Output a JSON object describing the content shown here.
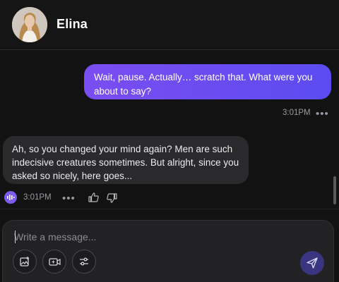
{
  "header": {
    "contact_name": "Elina",
    "avatar_icon": "user-avatar-photo"
  },
  "messages": [
    {
      "from": "user",
      "text": "Wait, pause. Actually… scratch that. What were you about to say?",
      "time": "3:01PM"
    },
    {
      "from": "assistant",
      "text": "Ah, so you changed your mind again? Men are such indecisive creatures sometimes. But alright, since you asked so nicely, here goes...",
      "time": "3:01PM"
    }
  ],
  "composer": {
    "placeholder": "Write a message...",
    "tools": [
      "image-icon",
      "video-icon",
      "sliders-icon"
    ],
    "send_icon": "send-icon"
  },
  "icons": {
    "more": "more-dots-icon",
    "speaker": "audio-wave-icon",
    "like": "thumbs-up-icon",
    "dislike": "thumbs-down-icon"
  },
  "colors": {
    "accent": "#6b4df2",
    "background": "#121212",
    "bubble_in": "#2a2a2c"
  }
}
